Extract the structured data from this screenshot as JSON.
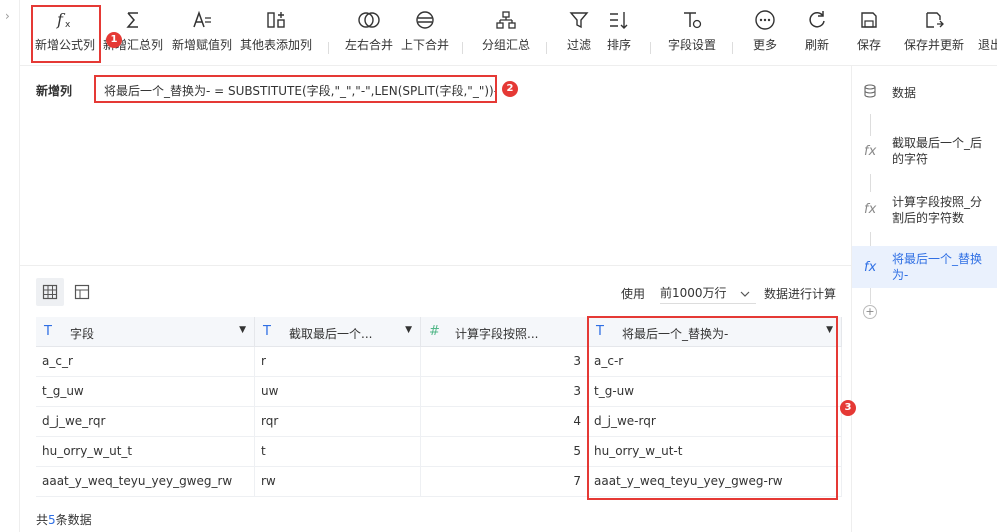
{
  "toolbar": {
    "items": [
      {
        "label": "新增公式列",
        "icon": "fx-icon"
      },
      {
        "label": "新增汇总列",
        "icon": "sigma-icon"
      },
      {
        "label": "新增赋值列",
        "icon": "assign-icon"
      },
      {
        "label": "其他表添加列",
        "icon": "table-add-icon"
      },
      {
        "label": "左右合并",
        "icon": "horizontal-merge-icon"
      },
      {
        "label": "上下合并",
        "icon": "vertical-merge-icon"
      },
      {
        "label": "分组汇总",
        "icon": "group-icon"
      },
      {
        "label": "过滤",
        "icon": "filter-icon"
      },
      {
        "label": "排序",
        "icon": "sort-icon"
      },
      {
        "label": "字段设置",
        "icon": "field-settings-icon"
      },
      {
        "label": "更多",
        "icon": "more-icon"
      },
      {
        "label": "刷新",
        "icon": "refresh-icon"
      },
      {
        "label": "保存",
        "icon": "save-icon"
      },
      {
        "label": "保存并更新",
        "icon": "save-update-icon"
      },
      {
        "label": "退出",
        "icon": "exit-icon"
      }
    ]
  },
  "formula": {
    "label": "新增列",
    "text": "将最后一个_替换为- = SUBSTITUTE(字段,\"_\",\"-\",LEN(SPLIT(字段,\"_\"))-1)"
  },
  "annotations": {
    "one": "1",
    "two": "2",
    "three": "3"
  },
  "steps": {
    "items": [
      {
        "label": "数据",
        "icon": "database-icon"
      },
      {
        "label": "截取最后一个_后的字符",
        "icon": "fx-icon"
      },
      {
        "label": "计算字段按照_分割后的字符数",
        "icon": "fx-icon"
      },
      {
        "label": "将最后一个_替换为-",
        "icon": "fx-icon"
      }
    ],
    "add": "+"
  },
  "table_controls": {
    "use_label": "使用",
    "rows_option": "前1000万行",
    "calc_label": "数据进行计算"
  },
  "grid": {
    "columns": [
      {
        "name": "字段",
        "type": "T"
      },
      {
        "name": "截取最后一个...",
        "type": "T"
      },
      {
        "name": "计算字段按照...",
        "type": "#"
      },
      {
        "name": "将最后一个_替换为-",
        "type": "T"
      }
    ],
    "rows": [
      [
        "a_c_r",
        "r",
        "3",
        "a_c-r"
      ],
      [
        "t_g_uw",
        "uw",
        "3",
        "t_g-uw"
      ],
      [
        "d_j_we_rqr",
        "rqr",
        "4",
        "d_j_we-rqr"
      ],
      [
        "hu_orry_w_ut_t",
        "t",
        "5",
        "hu_orry_w_ut-t"
      ],
      [
        "aaat_y_weq_teyu_yey_gweg_rw",
        "rw",
        "7",
        "aaat_y_weq_teyu_yey_gweg-rw"
      ]
    ]
  },
  "footer": {
    "prefix": "共",
    "count": "5",
    "suffix": "条数据"
  }
}
